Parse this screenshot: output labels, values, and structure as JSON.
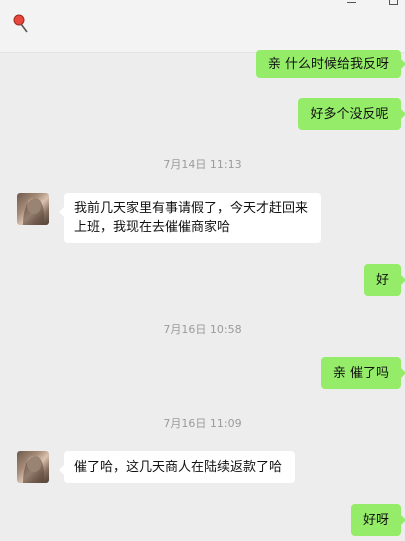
{
  "window": {
    "pin_icon": "pushpin-icon",
    "minimize_icon": "minimize-icon",
    "maximize_icon": "maximize-icon"
  },
  "colors": {
    "outgoing_bubble": "#95ec69",
    "incoming_bubble": "#ffffff",
    "background": "#ededed",
    "timestamp": "#9b9b9b"
  },
  "messages": [
    {
      "direction": "out",
      "text": "亲 什么时候给我反呀"
    },
    {
      "direction": "out",
      "text": "好多个没反呢"
    },
    {
      "type": "timestamp",
      "text": "7月14日 11:13"
    },
    {
      "direction": "in",
      "text_line1": "我前几天家里有事请假了，今天才赶回来",
      "text_line2": "上班，我现在去催催商家哈",
      "avatar": "contact-avatar"
    },
    {
      "direction": "out",
      "text": "好"
    },
    {
      "type": "timestamp",
      "text": "7月16日 10:58"
    },
    {
      "direction": "out",
      "text": "亲 催了吗"
    },
    {
      "type": "timestamp",
      "text": "7月16日 11:09"
    },
    {
      "direction": "in",
      "text": "催了哈，这几天商人在陆续返款了哈",
      "avatar": "contact-avatar"
    },
    {
      "direction": "out",
      "text": "好呀"
    }
  ]
}
